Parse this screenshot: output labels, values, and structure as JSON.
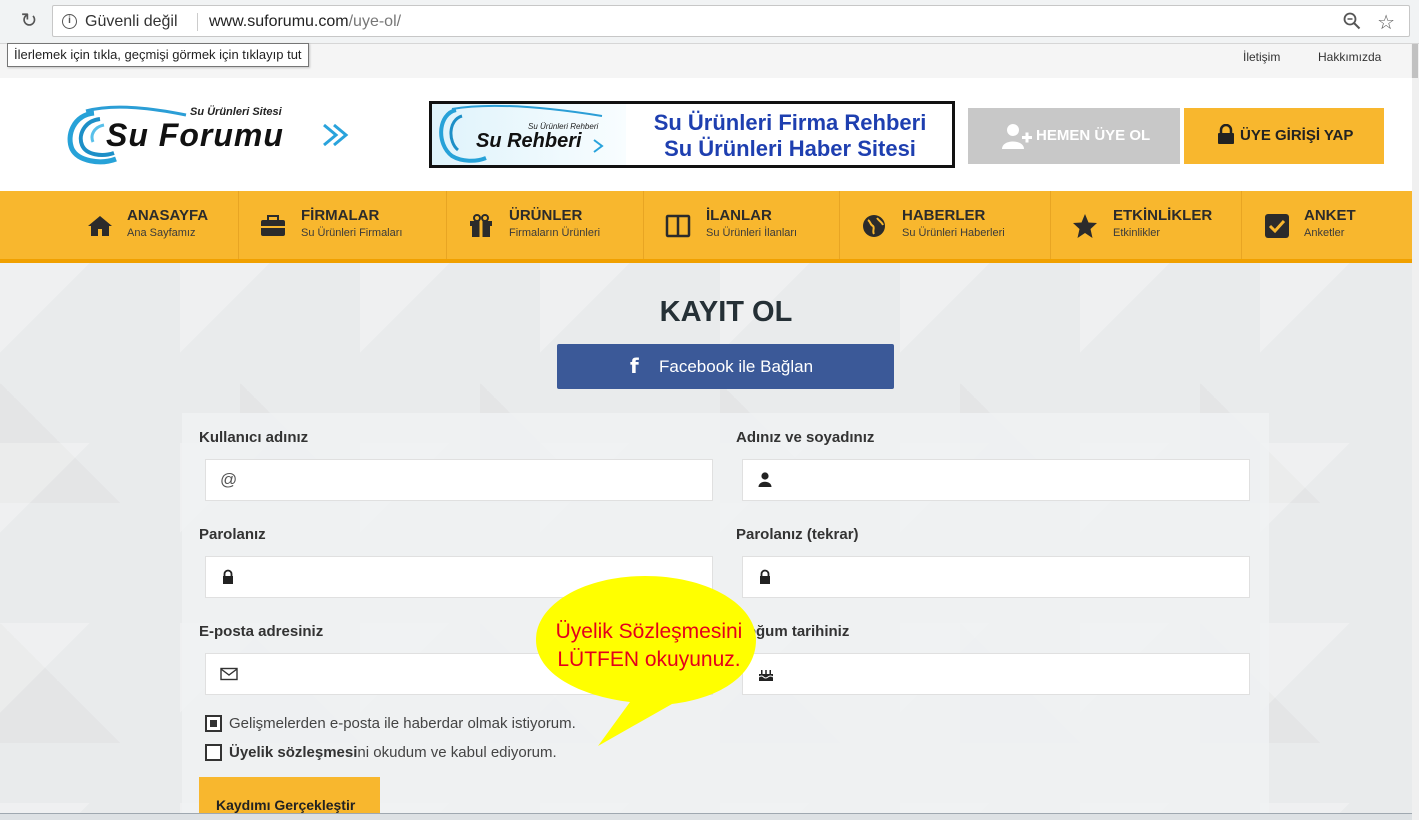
{
  "browser": {
    "security_label": "Güvenli değil",
    "url_host": "www.suforumu.com",
    "url_path": "/uye-ol/",
    "back_tooltip": "İlerlemek için tıkla, geçmişi görmek için tıklayıp tut"
  },
  "topbar": {
    "contact": "İletişim",
    "about": "Hakkımızda"
  },
  "header": {
    "logo_sub": "Su Ürünleri Sitesi",
    "logo_main": "Su Forumu",
    "banner_logo": "Su Rehberi",
    "banner_logo_sub": "Su Ürünleri Rehberi",
    "banner_line1": "Su Ürünleri Firma Rehberi",
    "banner_line2": "Su Ürünleri Haber Sitesi",
    "register_label": "HEMEN ÜYE OL",
    "login_label": "ÜYE GİRİŞİ YAP"
  },
  "nav": [
    {
      "title": "ANASAYFA",
      "sub": "Ana Sayfamız",
      "icon": "home-icon"
    },
    {
      "title": "FİRMALAR",
      "sub": "Su Ürünleri Firmaları",
      "icon": "briefcase-icon"
    },
    {
      "title": "ÜRÜNLER",
      "sub": "Firmaların Ürünleri",
      "icon": "gift-icon"
    },
    {
      "title": "İLANLAR",
      "sub": "Su Ürünleri İlanları",
      "icon": "columns-icon"
    },
    {
      "title": "HABERLER",
      "sub": "Su Ürünleri Haberleri",
      "icon": "globe-icon"
    },
    {
      "title": "ETKİNLİKLER",
      "sub": "Etkinlikler",
      "icon": "star-icon"
    },
    {
      "title": "ANKET",
      "sub": "Anketler",
      "icon": "checkbox-icon"
    }
  ],
  "form": {
    "title": "KAYIT OL",
    "facebook_label": "Facebook ile Bağlan",
    "username_label": "Kullanıcı adınız",
    "fullname_label": "Adınız ve soyadınız",
    "password_label": "Parolanız",
    "password2_label": "Parolanız (tekrar)",
    "email_label": "E-posta adresiniz",
    "birthdate_label": "Doğum tarihiniz",
    "username_icon": "@",
    "newsletter_label": "Gelişmelerden e-posta ile haberdar olmak istiyorum.",
    "newsletter_checked": true,
    "agreement_bold": "Üyelik sözleşmesi",
    "agreement_rest": "ni okudum ve kabul ediyorum.",
    "agreement_checked": false,
    "submit_label": "Kaydımı Gerçekleştir"
  },
  "callout": {
    "line1": "Üyelik Sözleşmesini",
    "line2": "LÜTFEN okuyunuz.",
    "fill": "#ffff00",
    "text_color": "#e4001b"
  },
  "colors": {
    "accent": "#f8b72e",
    "facebook": "#3b5998",
    "register_btn": "#c8c8c8"
  }
}
